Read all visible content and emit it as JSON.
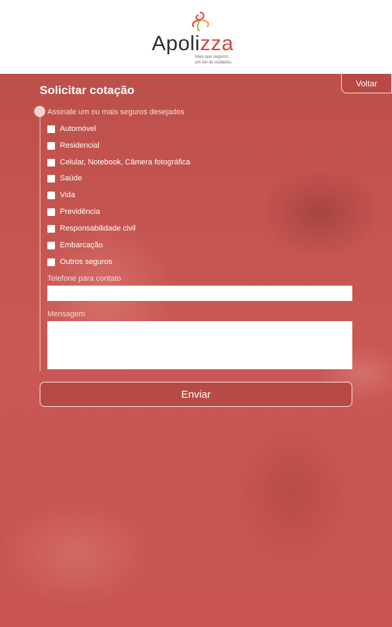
{
  "header": {
    "logo": {
      "text_prefix": "Apoli",
      "text_accent": "zza",
      "tagline_line1": "Mais que seguros,",
      "tagline_line2": "um elo de cuidados."
    }
  },
  "form": {
    "title": "Solicitar cotação",
    "back_label": "Voltar",
    "instruction": "Assinale um ou mais seguros desejados",
    "options": [
      {
        "label": "Automóvel",
        "checked": false
      },
      {
        "label": "Residencial",
        "checked": false
      },
      {
        "label": "Celular, Notebook, Câmera fotográfica",
        "checked": false
      },
      {
        "label": "Saúde",
        "checked": false
      },
      {
        "label": "Vida",
        "checked": false
      },
      {
        "label": "Previdência",
        "checked": false
      },
      {
        "label": "Responsabilidade civil",
        "checked": false
      },
      {
        "label": "Embarcação",
        "checked": false
      },
      {
        "label": "Outros seguros",
        "checked": false
      }
    ],
    "phone_label": "Telefone para contato",
    "phone_value": "",
    "message_label": "Mensagem",
    "message_value": "",
    "send_label": "Enviar"
  },
  "colors": {
    "brand_accent": "#d4443b",
    "overlay": "#c0504d"
  }
}
